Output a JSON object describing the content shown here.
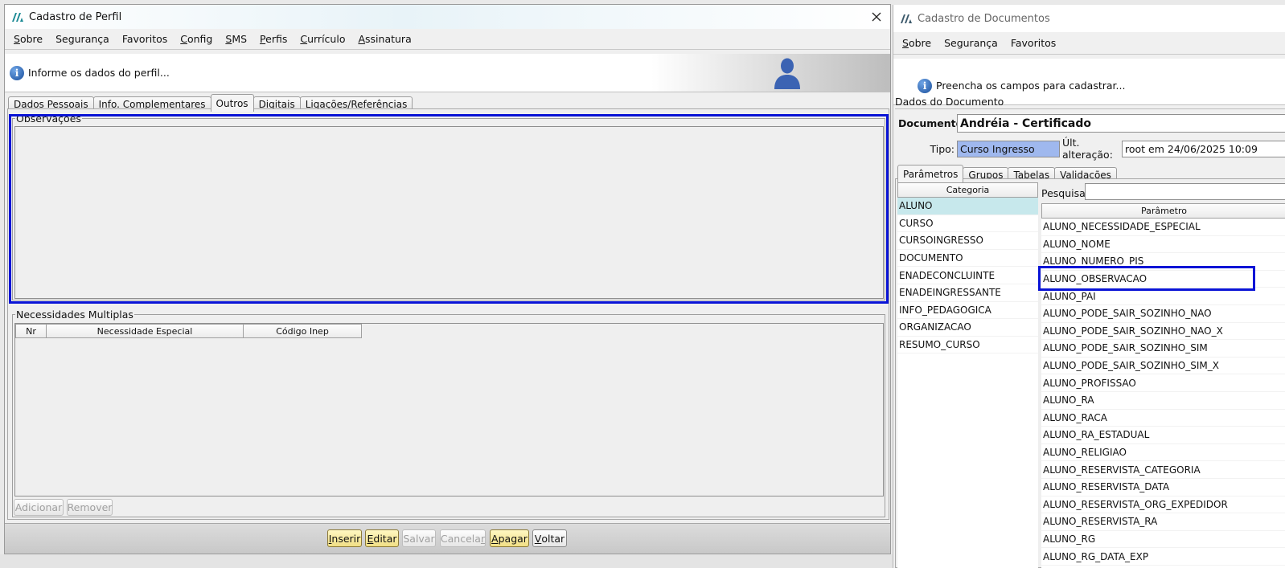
{
  "win1": {
    "title": "Cadastro de Perfil",
    "menu": [
      {
        "mn": "S",
        "rest": "obre"
      },
      {
        "mn": "",
        "rest": "Segurança"
      },
      {
        "mn": "",
        "rest": "Favoritos"
      },
      {
        "mn": "C",
        "rest": "onfig"
      },
      {
        "mn": "S",
        "rest": "MS"
      },
      {
        "mn": "P",
        "rest": "erfis"
      },
      {
        "mn": "C",
        "rest": "urrículo"
      },
      {
        "mn": "A",
        "rest": "ssinatura"
      }
    ],
    "banner_text": "Informe os dados do perfil...",
    "tabs": [
      "Dados Pessoais",
      "Info. Complementares",
      "Outros",
      "Digitais",
      "Ligações/Referências"
    ],
    "active_tab": "Outros",
    "observacoes_legend": "Observações",
    "necessidades_legend": "Necessidades Multiplas",
    "necessidades_columns": [
      "Nr",
      "Necessidade Especial",
      "Código Inep"
    ],
    "adicionar_label": "Adicionar",
    "remover_label": "Remover",
    "footer_buttons": {
      "inserir": {
        "mn": "I",
        "rest": "nserir"
      },
      "editar": {
        "mn": "E",
        "rest": "ditar"
      },
      "salvar": "Salvar",
      "cancelar_pre": "Cancela",
      "cancelar_mn": "r",
      "apagar": {
        "mn": "A",
        "rest": "pagar"
      },
      "voltar": {
        "mn": "V",
        "rest": "oltar"
      }
    }
  },
  "win2": {
    "title": "Cadastro de Documentos",
    "menu": [
      {
        "mn": "S",
        "rest": "obre"
      },
      {
        "mn": "",
        "rest": "Segurança"
      },
      {
        "mn": "",
        "rest": "Favoritos"
      }
    ],
    "banner_text": "Preencha os campos para cadastrar...",
    "section_title": "Dados do Documento",
    "documento_label": "Documento:",
    "documento_value": "Andréia - Certificado",
    "tipo_label": "Tipo:",
    "tipo_value": "Curso Ingresso",
    "alteracao_label": "Últ. alteração:",
    "alteracao_value": "root em 24/06/2025 10:09",
    "tabs": [
      "Parâmetros",
      "Grupos",
      "Tabelas",
      "Validações"
    ],
    "active_tab": "Parâmetros",
    "categoria_header": "Categoria",
    "categorias": [
      "ALUNO",
      "CURSO",
      "CURSOINGRESSO",
      "DOCUMENTO",
      "ENADECONCLUINTE",
      "ENADEINGRESSANTE",
      "INFO_PEDAGOGICA",
      "ORGANIZACAO",
      "RESUMO_CURSO"
    ],
    "selected_categoria": "ALUNO",
    "pesquisar_label": "Pesquisar:",
    "parametro_header": "Parâmetro",
    "parametros": [
      "ALUNO_NECESSIDADE_ESPECIAL",
      "ALUNO_NOME",
      "ALUNO_NUMERO_PIS",
      "ALUNO_OBSERVACAO",
      "ALUNO_PAI",
      "ALUNO_PODE_SAIR_SOZINHO_NAO",
      "ALUNO_PODE_SAIR_SOZINHO_NAO_X",
      "ALUNO_PODE_SAIR_SOZINHO_SIM",
      "ALUNO_PODE_SAIR_SOZINHO_SIM_X",
      "ALUNO_PROFISSAO",
      "ALUNO_RA",
      "ALUNO_RACA",
      "ALUNO_RA_ESTADUAL",
      "ALUNO_RELIGIAO",
      "ALUNO_RESERVISTA_CATEGORIA",
      "ALUNO_RESERVISTA_DATA",
      "ALUNO_RESERVISTA_ORG_EXPEDIDOR",
      "ALUNO_RESERVISTA_RA",
      "ALUNO_RG",
      "ALUNO_RG_DATA_EXP"
    ],
    "highlighted_parametro": "ALUNO_OBSERVACAO"
  },
  "colors": {
    "highlight": "#0a14d6",
    "selected_row": "#c7e8ec",
    "tipo_field": "#9fb8ee",
    "yellow_button": "#f1df85"
  }
}
